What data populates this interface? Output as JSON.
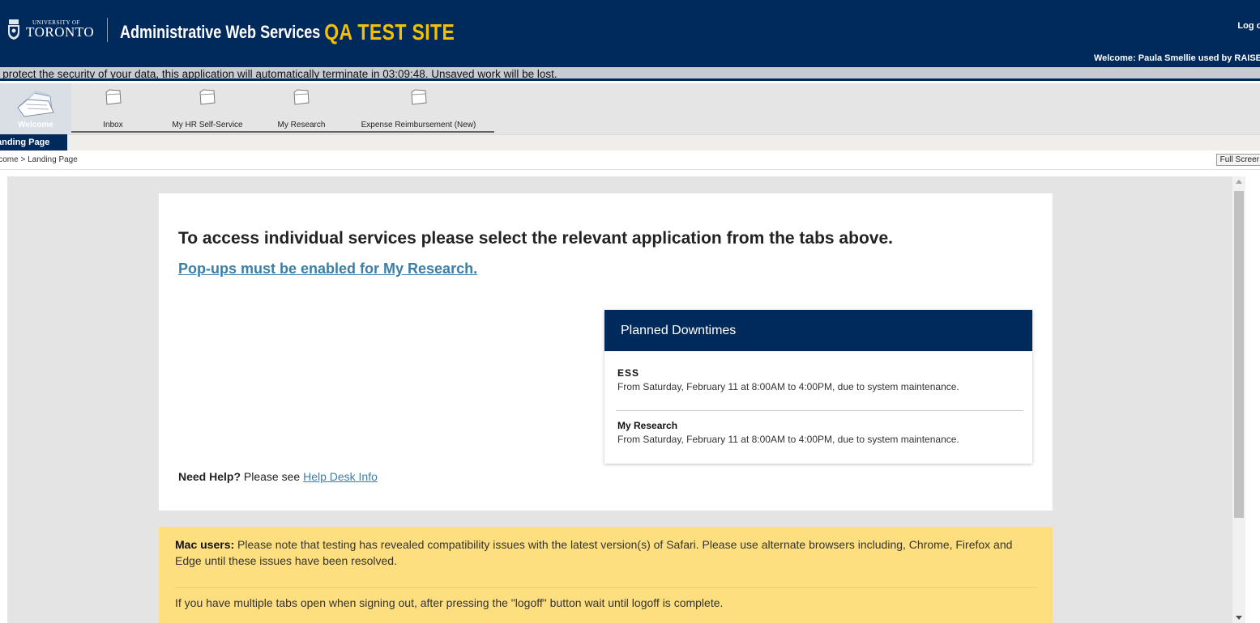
{
  "header": {
    "logo_small": "UNIVERSITY OF",
    "logo_big": "TORONTO",
    "app_title": "Administrative Web Services",
    "test_site": "QA TEST SITE",
    "logoff": "Log of",
    "welcome": "Welcome: Paula Smellie used by RAISE"
  },
  "session_bar": {
    "text": "o protect the security of your data, this application will automatically terminate in 03:09:48. Unsaved work will be lost."
  },
  "tabs": [
    {
      "label": "Welcome",
      "icon": "documents-icon",
      "active": true
    },
    {
      "label": "Inbox",
      "icon": "folder-icon"
    },
    {
      "label": "My HR Self-Service",
      "icon": "folder-icon"
    },
    {
      "label": "My Research",
      "icon": "folder-icon"
    },
    {
      "label": "Expense Reimbursement (New)",
      "icon": "folder-icon"
    }
  ],
  "subnav": {
    "landing_page": "anding Page"
  },
  "breadcrumb": {
    "text": "lcome  >  Landing Page",
    "full_screen": "Full Screer"
  },
  "main": {
    "heading": "To access individual services please select the relevant application from the tabs above.",
    "popup_link": "Pop-ups must be enabled for My Research.",
    "help_bold": "Need Help?",
    "help_text": " Please see ",
    "help_link": "Help Desk Info"
  },
  "downtimes": {
    "title": "Planned Downtimes",
    "items": [
      {
        "title": "ESS",
        "desc": "From Saturday, February 11 at 8:00AM to 4:00PM, due to system maintenance."
      },
      {
        "title": "My Research",
        "desc": "From Saturday, February 11 at 8:00AM to 4:00PM, due to system maintenance."
      }
    ]
  },
  "notice": {
    "mac_bold": "Mac users:",
    "mac_text": " Please note that testing has revealed compatibility issues with the latest version(s) of Safari. Please use alternate browsers including, Chrome, Firefox and Edge until these issues have been resolved.",
    "logoff_text": "If you have multiple tabs open when signing out, after pressing the \"logoff\" button wait until logoff is complete."
  },
  "colors": {
    "navy": "#012a5c",
    "gold": "#f2c100",
    "link": "#3b7ea6",
    "notice": "#fedf80"
  }
}
